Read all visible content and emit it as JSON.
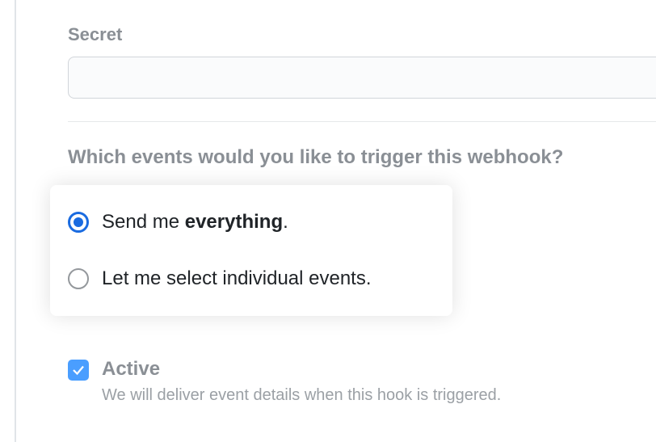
{
  "secret": {
    "label": "Secret",
    "value": ""
  },
  "events": {
    "heading": "Which events would you like to trigger this webhook?",
    "options": {
      "everything_prefix": "Send me ",
      "everything_bold": "everything",
      "everything_suffix": ".",
      "individual": "Let me select individual events."
    }
  },
  "active": {
    "label": "Active",
    "help": "We will deliver event details when this hook is triggered."
  }
}
